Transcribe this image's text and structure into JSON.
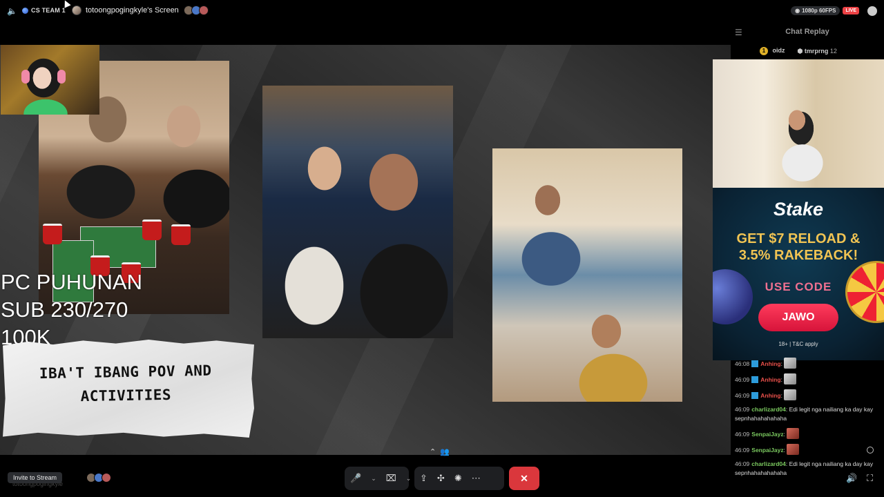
{
  "topbar": {
    "channel_name": "CS TEAM 1",
    "screen_title": "totoongpogingkyle's Screen",
    "quality": "1080p 60FPS",
    "live_label": "LIVE"
  },
  "stream": {
    "overlay_lines": [
      "PC PUHUNAN",
      "SUB 230/270",
      "100K"
    ],
    "paper_text": [
      "IBA'T IBANG POV AND",
      "ACTIVITIES"
    ]
  },
  "chat": {
    "title": "Chat Replay",
    "top_users": [
      {
        "rank": "1",
        "name": "oidz"
      },
      {
        "name": "tmrprng",
        "count": "12"
      }
    ],
    "messages": [
      {
        "time": "46:08",
        "user": "Anhing",
        "text": "",
        "emote": true
      },
      {
        "time": "46:09",
        "user": "Anhing",
        "text": "",
        "emote": true
      },
      {
        "time": "46:09",
        "user": "Anhing",
        "text": "",
        "emote": true
      },
      {
        "time": "46:09",
        "user": "charlizard04",
        "text": "Edi legit nga nailiang ka day kay sepnhahahahahaha"
      },
      {
        "time": "46:09",
        "user": "SenpaiJayz",
        "text": "",
        "emote": true
      },
      {
        "time": "46:09",
        "user": "SenpaiJayz",
        "text": "",
        "emote": true
      },
      {
        "time": "46:09",
        "user": "charlizard04",
        "text": "Edi legit nga nailiang ka day kay sepnhahahahahaha"
      }
    ]
  },
  "ad": {
    "brand": "Stake",
    "headline_1": "GET $7 RELOAD &",
    "headline_2": "3.5% RAKEBACK!",
    "use_code": "USE CODE",
    "code_button": "JAWO",
    "footer": "18+ | T&C apply"
  },
  "bottom": {
    "invite_label": "Invite to Stream",
    "ghost_name": "totoongpogingkyle"
  },
  "colors": {
    "live": "#ed4245",
    "end_call": "#da373c",
    "chat_user_red": "#e8504a",
    "chat_user_green": "#7bc95f",
    "ad_headline": "#f1c453"
  }
}
